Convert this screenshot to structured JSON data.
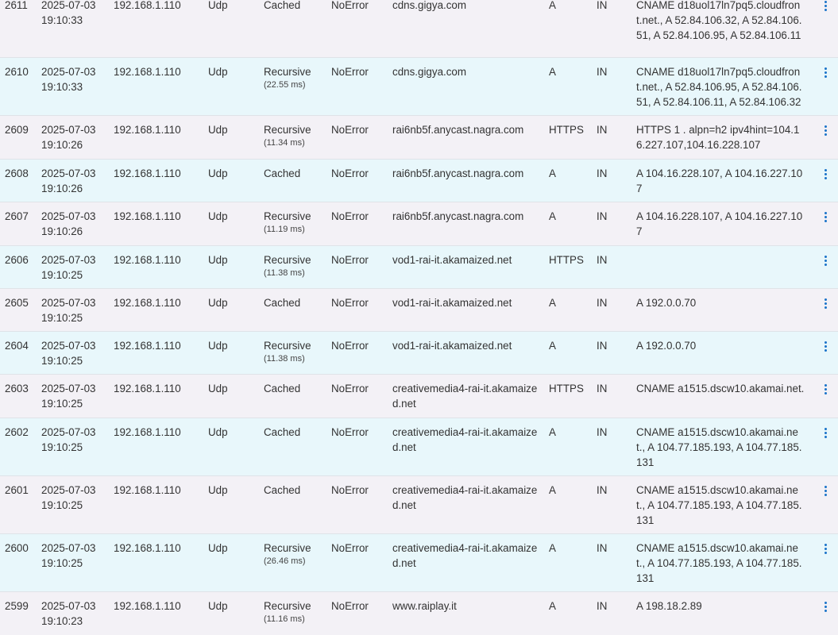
{
  "rows": [
    {
      "id": "2611",
      "date": "2025-07-03",
      "time": "19:10:33",
      "client": "192.168.1.110",
      "protocol": "Udp",
      "response_type": "Cached",
      "response_time": "",
      "rcode": "NoError",
      "domain": "cdns.gigya.com",
      "qtype": "A",
      "qclass": "IN",
      "answer": "CNAME d18uol17ln7pq5.cloudfront.net., A 52.84.106.32, A 52.84.106.51, A 52.84.106.95, A 52.84.106.11"
    },
    {
      "id": "2610",
      "date": "2025-07-03",
      "time": "19:10:33",
      "client": "192.168.1.110",
      "protocol": "Udp",
      "response_type": "Recursive",
      "response_time": "(22.55 ms)",
      "rcode": "NoError",
      "domain": "cdns.gigya.com",
      "qtype": "A",
      "qclass": "IN",
      "answer": "CNAME d18uol17ln7pq5.cloudfront.net., A 52.84.106.95, A 52.84.106.51, A 52.84.106.11, A 52.84.106.32"
    },
    {
      "id": "2609",
      "date": "2025-07-03",
      "time": "19:10:26",
      "client": "192.168.1.110",
      "protocol": "Udp",
      "response_type": "Recursive",
      "response_time": "(11.34 ms)",
      "rcode": "NoError",
      "domain": "rai6nb5f.anycast.nagra.com",
      "qtype": "HTTPS",
      "qclass": "IN",
      "answer": "HTTPS 1 . alpn=h2 ipv4hint=104.16.227.107,104.16.228.107"
    },
    {
      "id": "2608",
      "date": "2025-07-03",
      "time": "19:10:26",
      "client": "192.168.1.110",
      "protocol": "Udp",
      "response_type": "Cached",
      "response_time": "",
      "rcode": "NoError",
      "domain": "rai6nb5f.anycast.nagra.com",
      "qtype": "A",
      "qclass": "IN",
      "answer": "A 104.16.228.107, A 104.16.227.107"
    },
    {
      "id": "2607",
      "date": "2025-07-03",
      "time": "19:10:26",
      "client": "192.168.1.110",
      "protocol": "Udp",
      "response_type": "Recursive",
      "response_time": "(11.19 ms)",
      "rcode": "NoError",
      "domain": "rai6nb5f.anycast.nagra.com",
      "qtype": "A",
      "qclass": "IN",
      "answer": "A 104.16.228.107, A 104.16.227.107"
    },
    {
      "id": "2606",
      "date": "2025-07-03",
      "time": "19:10:25",
      "client": "192.168.1.110",
      "protocol": "Udp",
      "response_type": "Recursive",
      "response_time": "(11.38 ms)",
      "rcode": "NoError",
      "domain": "vod1-rai-it.akamaized.net",
      "qtype": "HTTPS",
      "qclass": "IN",
      "answer": ""
    },
    {
      "id": "2605",
      "date": "2025-07-03",
      "time": "19:10:25",
      "client": "192.168.1.110",
      "protocol": "Udp",
      "response_type": "Cached",
      "response_time": "",
      "rcode": "NoError",
      "domain": "vod1-rai-it.akamaized.net",
      "qtype": "A",
      "qclass": "IN",
      "answer": "A 192.0.0.70"
    },
    {
      "id": "2604",
      "date": "2025-07-03",
      "time": "19:10:25",
      "client": "192.168.1.110",
      "protocol": "Udp",
      "response_type": "Recursive",
      "response_time": "(11.38 ms)",
      "rcode": "NoError",
      "domain": "vod1-rai-it.akamaized.net",
      "qtype": "A",
      "qclass": "IN",
      "answer": "A 192.0.0.70"
    },
    {
      "id": "2603",
      "date": "2025-07-03",
      "time": "19:10:25",
      "client": "192.168.1.110",
      "protocol": "Udp",
      "response_type": "Cached",
      "response_time": "",
      "rcode": "NoError",
      "domain": "creativemedia4-rai-it.akamaized.net",
      "qtype": "HTTPS",
      "qclass": "IN",
      "answer": "CNAME a1515.dscw10.akamai.net."
    },
    {
      "id": "2602",
      "date": "2025-07-03",
      "time": "19:10:25",
      "client": "192.168.1.110",
      "protocol": "Udp",
      "response_type": "Cached",
      "response_time": "",
      "rcode": "NoError",
      "domain": "creativemedia4-rai-it.akamaized.net",
      "qtype": "A",
      "qclass": "IN",
      "answer": "CNAME a1515.dscw10.akamai.net., A 104.77.185.193, A 104.77.185.131"
    },
    {
      "id": "2601",
      "date": "2025-07-03",
      "time": "19:10:25",
      "client": "192.168.1.110",
      "protocol": "Udp",
      "response_type": "Cached",
      "response_time": "",
      "rcode": "NoError",
      "domain": "creativemedia4-rai-it.akamaized.net",
      "qtype": "A",
      "qclass": "IN",
      "answer": "CNAME a1515.dscw10.akamai.net., A 104.77.185.193, A 104.77.185.131"
    },
    {
      "id": "2600",
      "date": "2025-07-03",
      "time": "19:10:25",
      "client": "192.168.1.110",
      "protocol": "Udp",
      "response_type": "Recursive",
      "response_time": "(26.46 ms)",
      "rcode": "NoError",
      "domain": "creativemedia4-rai-it.akamaized.net",
      "qtype": "A",
      "qclass": "IN",
      "answer": "CNAME a1515.dscw10.akamai.net., A 104.77.185.193, A 104.77.185.131"
    },
    {
      "id": "2599",
      "date": "2025-07-03",
      "time": "19:10:23",
      "client": "192.168.1.110",
      "protocol": "Udp",
      "response_type": "Recursive",
      "response_time": "(11.16 ms)",
      "rcode": "NoError",
      "domain": "www.raiplay.it",
      "qtype": "A",
      "qclass": "IN",
      "answer": "A 198.18.2.89"
    }
  ],
  "icons": {
    "row_menu": "kebab-vertical-icon"
  },
  "colors": {
    "row_odd": "#f3f1f6",
    "row_even": "#e8f7fb",
    "accent": "#1a73c9",
    "text": "#333333"
  }
}
